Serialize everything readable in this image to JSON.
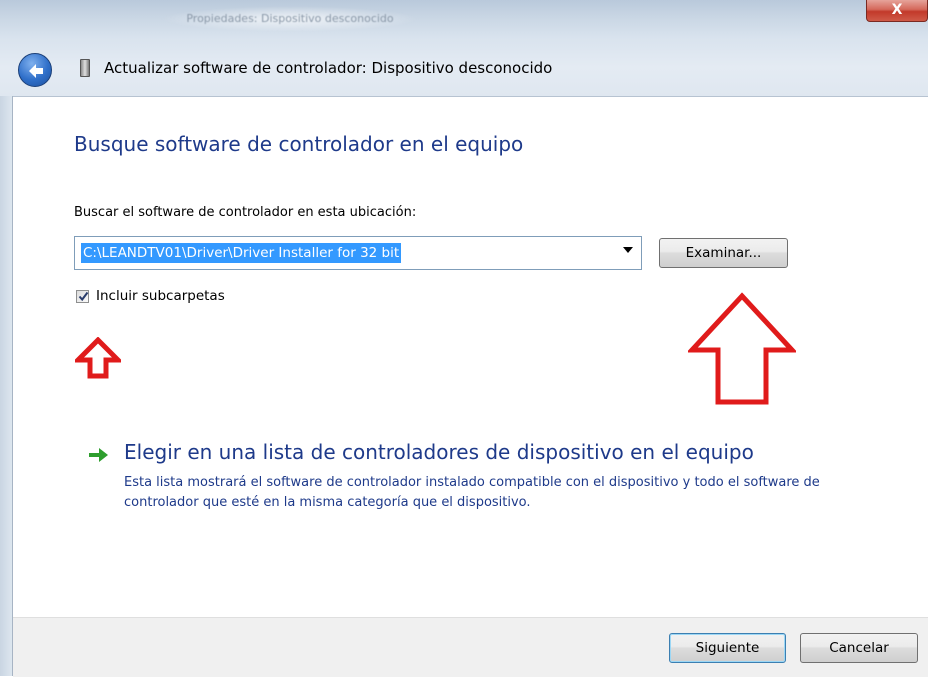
{
  "window": {
    "blurred_title": "Propiedades: Dispositivo desconocido",
    "close_label": "X"
  },
  "wizard": {
    "title": "Actualizar software de controlador: Dispositivo desconocido"
  },
  "main": {
    "heading": "Busque software de controlador en el equipo",
    "location_label": "Buscar el software de controlador en esta ubicación:",
    "location_value": "C:\\LEANDTV01\\Driver\\Driver Installer for 32 bit",
    "browse_button": "Examinar...",
    "include_subfolders": {
      "label": "Incluir subcarpetas",
      "checked": true
    },
    "pick_option": {
      "title": "Elegir en una lista de controladores de dispositivo en el equipo",
      "description": "Esta lista mostrará el software de controlador instalado compatible con el dispositivo y todo el software de controlador que esté en la misma categoría que el dispositivo."
    }
  },
  "footer": {
    "next_button": "Siguiente",
    "cancel_button": "Cancelar"
  },
  "colors": {
    "heading": "#1e3a8a",
    "selection": "#3399ff",
    "annotation_arrow": "#e01b1b",
    "link_arrow": "#2e9e2e"
  },
  "icons": [
    "back-arrow-icon",
    "device-icon",
    "checkmark-icon",
    "green-arrow-icon"
  ]
}
